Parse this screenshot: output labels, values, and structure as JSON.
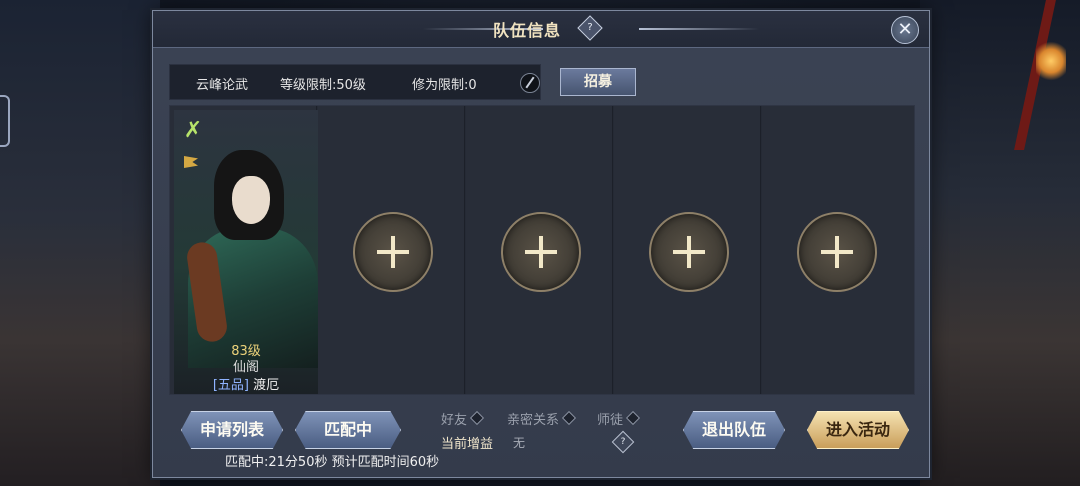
{
  "window": {
    "title": "队伍信息",
    "help_icon": "question-icon",
    "close_icon": "close-icon"
  },
  "team_info": {
    "activity": "云峰论武",
    "level_limit": "等级限制:50级",
    "cultivation_limit": "修为限制:0",
    "edit_icon": "pen-icon",
    "recruit_label": "招募"
  },
  "members": [
    {
      "level": "83级",
      "sect": "仙阁",
      "rank": "[五品]",
      "name": "渡厄",
      "sect_icon": "sect-emblem-icon"
    }
  ],
  "empty_slots": [
    {
      "icon": "plus-icon"
    },
    {
      "icon": "plus-icon"
    },
    {
      "icon": "plus-icon"
    },
    {
      "icon": "plus-icon"
    }
  ],
  "bottom": {
    "apply_list_label": "申请列表",
    "matching_label": "匹配中",
    "friend_tag": "好友",
    "intimate_tag": "亲密关系",
    "mentor_tag": "师徒",
    "bonus_label": "当前增益",
    "bonus_value": "无",
    "leave_team_label": "退出队伍",
    "enter_activity_label": "进入活动",
    "match_status": "匹配中:21分50秒  预计匹配时间60秒"
  },
  "colors": {
    "panel": "#3b4354",
    "gold_button": "#e3c27f",
    "blue_button": "#6478a0",
    "title_text": "#f1e3c0"
  }
}
